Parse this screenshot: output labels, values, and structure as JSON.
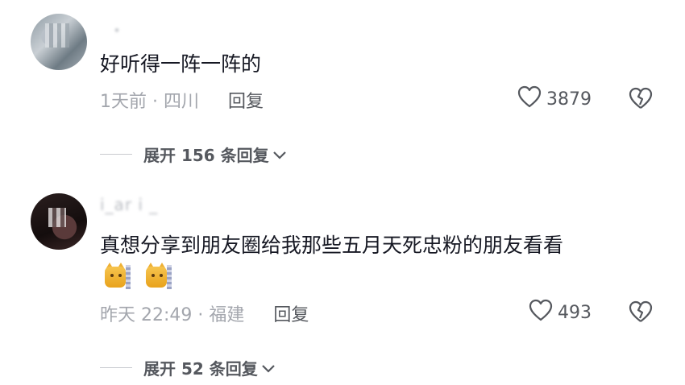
{
  "comments": [
    {
      "username": " ・ ",
      "text": "好听得一阵一阵的",
      "time_location": "1天前 · 四川",
      "reply_label": "回复",
      "like_count": "3879",
      "expand_label": "展开 156 条回复"
    },
    {
      "username": "i_ar i _",
      "text": "真想分享到朋友圈给我那些五月天死忠粉的朋友看看",
      "time_location": "昨天 22:49 · 福建",
      "reply_label": "回复",
      "like_count": "493",
      "expand_label": "展开 52 条回复"
    }
  ],
  "icons": {
    "like": "heart-outline-icon",
    "dislike": "broken-heart-icon",
    "expand": "chevron-down-icon"
  },
  "colors": {
    "text": "#161823",
    "meta": "#a3a6ad",
    "action": "#55585e"
  }
}
